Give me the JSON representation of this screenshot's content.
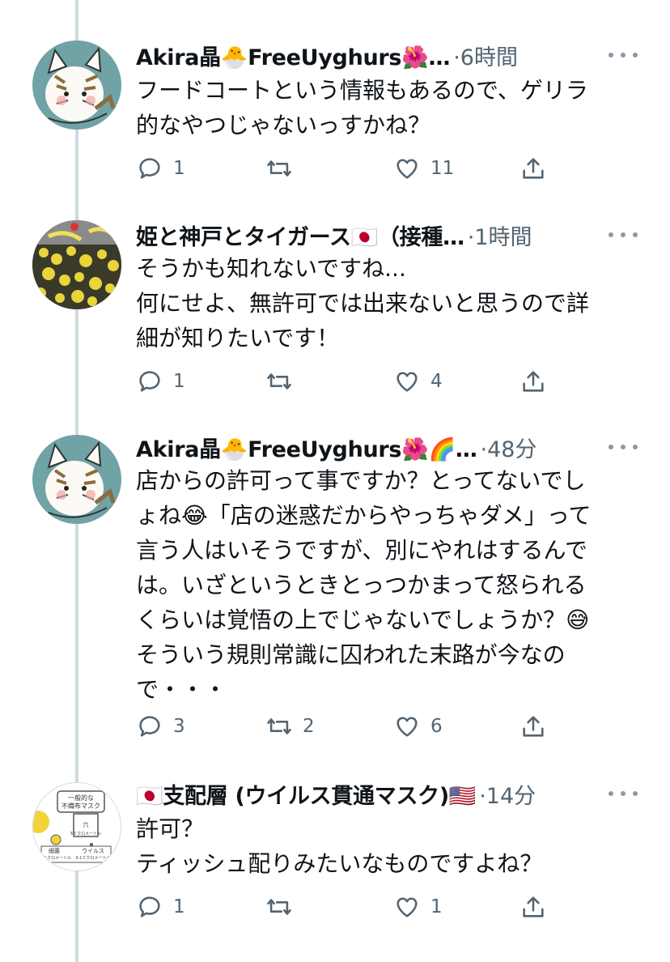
{
  "tweets": [
    {
      "name": "Akira晶🐣FreeUyghurs🌺…",
      "meta": "·6時間",
      "text": "フードコートという情報もあるので、ゲリラ\n的なやつじゃないっすかね？",
      "reply_count": "1",
      "retweet_count": "",
      "like_count": "11",
      "avatar": "cat-illustration-avatar"
    },
    {
      "name": "姫と神戸とタイガース🇯🇵（接種…",
      "meta": "·1時間",
      "text": "そうかも知れないですね...\n何にせよ、無許可では出来ないと思うので詳\n細が知りたいです！",
      "reply_count": "1",
      "retweet_count": "",
      "like_count": "4",
      "avatar": "stadium-crowd-avatar"
    },
    {
      "name": "Akira晶🐣FreeUyghurs🌺🌈…",
      "meta": "·48分",
      "text": "店からの許可って事ですか？とってないでし\nょね😂「店の迷惑だからやっちゃダメ」って\n言う人はいそうですが、別にやれはするんで\nは。いざというときとっつかまって怒られる\nくらいは覚悟の上でじゃないでしょうか？😅\nそういう規則常識に囚われた末路が今なの\nで・・・",
      "reply_count": "3",
      "retweet_count": "2",
      "like_count": "6",
      "avatar": "cat-illustration-avatar"
    },
    {
      "name": "🇯🇵支配層 (ウイルス貫通マスク)🇺🇸",
      "meta": "·14分",
      "text": "許可？\nティッシュ配りみたいなものですよね？",
      "reply_count": "1",
      "retweet_count": "",
      "like_count": "1",
      "avatar": "mask-diagram-avatar",
      "avatar_text": {
        "line1": "一般的な",
        "line2": "不織布マスク",
        "hole": "穴",
        "size": "5ミクロメートル",
        "label1": "細菌",
        "size1": "~2ミクロメートル",
        "label2": "ウイルス",
        "size2": "0.1ミクロメートル"
      }
    }
  ],
  "colors": {
    "text": "#0f1419",
    "secondary": "#536471",
    "thread_line": "#cfd9de",
    "icon": "#536471"
  }
}
